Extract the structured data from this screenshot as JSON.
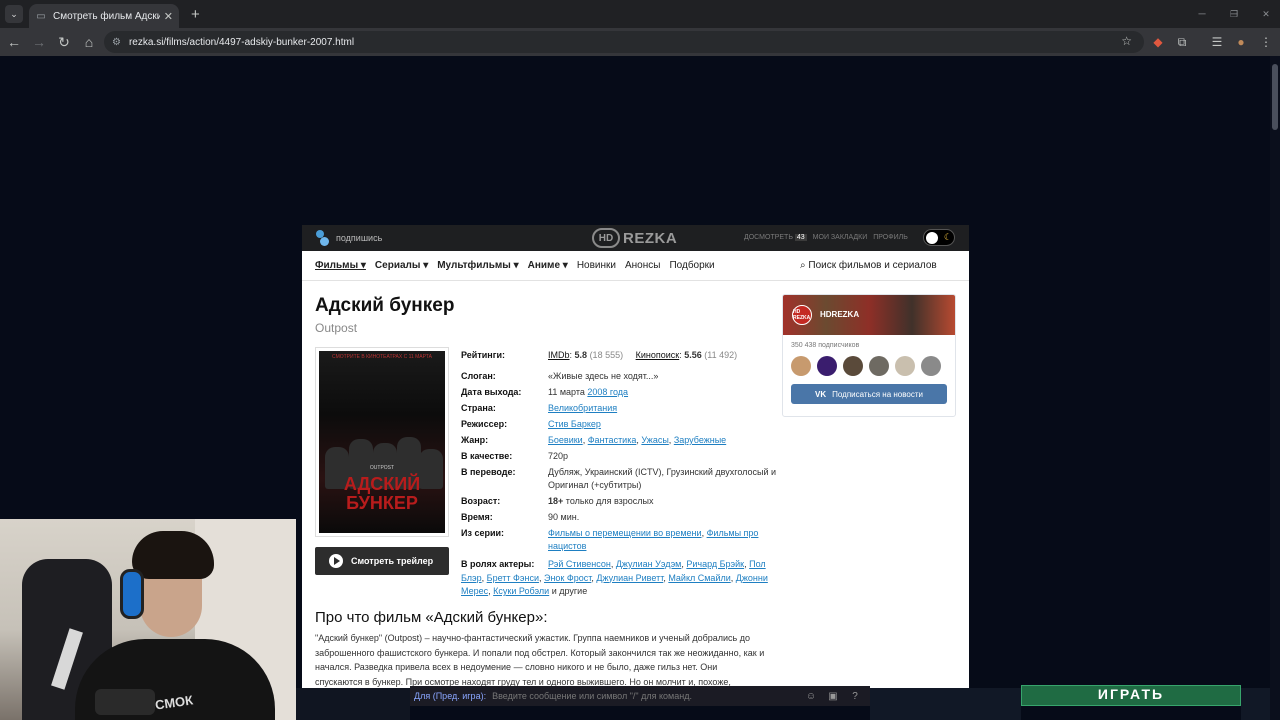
{
  "browser": {
    "tab_title": "Смотреть фильм Адский бункер",
    "url": "rezka.si/films/action/4497-adskiy-bunker-2007.html"
  },
  "site": {
    "subscribe_label": "подпишись",
    "logo_hd": "HD",
    "logo_text": "REZKA",
    "top_links": {
      "watch_later": "ДОСМОТРЕТЬ",
      "watch_count": "43",
      "bookmarks": "МОИ ЗАКЛАДКИ",
      "profile": "ПРОФИЛЬ"
    },
    "nav": [
      {
        "label": "Фильмы ▾"
      },
      {
        "label": "Сериалы ▾"
      },
      {
        "label": "Мультфильмы ▾"
      },
      {
        "label": "Аниме ▾"
      },
      {
        "label": "Новинки"
      },
      {
        "label": "Анонсы"
      },
      {
        "label": "Подборки"
      }
    ],
    "search_label": "Поиск фильмов и сериалов"
  },
  "film": {
    "title": "Адский бункер",
    "original_title": "Outpost",
    "poster": {
      "tagline": "СМОТРИТЕ В КИНОТЕАТРАХ С 11 МАРТА",
      "caption": "OUTPOST",
      "title_line1": "АДСКИЙ",
      "title_line2": "БУНКЕР"
    },
    "trailer_label": "Смотреть трейлер",
    "ratings_label": "Рейтинги:",
    "imdb_label": "IMDb",
    "imdb_score": "5.8",
    "imdb_votes": "(18 555)",
    "kp_label": "Кинопоиск",
    "kp_score": "5.56",
    "kp_votes": "(11 492)",
    "slogan_label": "Слоган:",
    "slogan": "«Живые здесь не ходят...»",
    "release_label": "Дата выхода:",
    "release_day": "11 марта",
    "release_year": "2008 года",
    "country_label": "Страна:",
    "country": "Великобритания",
    "director_label": "Режиссер:",
    "director": "Стив Баркер",
    "genre_label": "Жанр:",
    "genres": [
      "Боевики",
      "Фантастика",
      "Ужасы",
      "Зарубежные"
    ],
    "quality_label": "В качестве:",
    "quality": "720p",
    "translation_label": "В переводе:",
    "translation": "Дубляж, Украинский (ICTV), Грузинский двухголосый и Оригинал (+субтитры)",
    "age_label": "Возраст:",
    "age": "18+",
    "age_note": "только для взрослых",
    "duration_label": "Время:",
    "duration": "90 мин.",
    "series_label": "Из серии:",
    "series": [
      "Фильмы о перемещении во времени",
      "Фильмы про нацистов"
    ],
    "cast_label": "В ролях актеры:",
    "cast": [
      "Рэй Стивенсон",
      "Джулиан Уэдэм",
      "Ричард Брэйк",
      "Пол Блэр",
      "Бретт Фэнси",
      "Энок Фрост",
      "Джулиан Риветт",
      "Майкл Смайли",
      "Джонни Мерес",
      "Ксуки Робэли"
    ],
    "cast_more": "и другие",
    "about_title": "Про что фильм «Адский бункер»:",
    "about_text": "\"Адский бункер\" (Outpost) – научно-фантастический ужастик. Группа наемников и ученый добрались до заброшенного фашистского бункера. И попали под обстрел. Который закончился так же неожиданно, как и начался. Разведка привела всех в недоумение — словно никого и не было, даже гильз нет. Они спускаются в бункер. При осмотре находят груду тел и одного выжившего. Но он молчит и, похоже,"
  },
  "vk_widget": {
    "logo": "HD REZKA",
    "name": "HDREZKA",
    "subscribers": "350 438 подписчиков",
    "button_icon": "VK",
    "button_label": "Подписаться на новости"
  },
  "overlay": {
    "chat_prefix": "Для (Пред. игра):",
    "chat_placeholder": "Введите сообщение или символ \"/\" для команд.",
    "play_button": "ИГРАТЬ",
    "shirt_text": "СМОК"
  },
  "colors": {
    "link": "#1e7fc2",
    "vk_button": "#4a76a8",
    "page_bg": "#060b18"
  }
}
